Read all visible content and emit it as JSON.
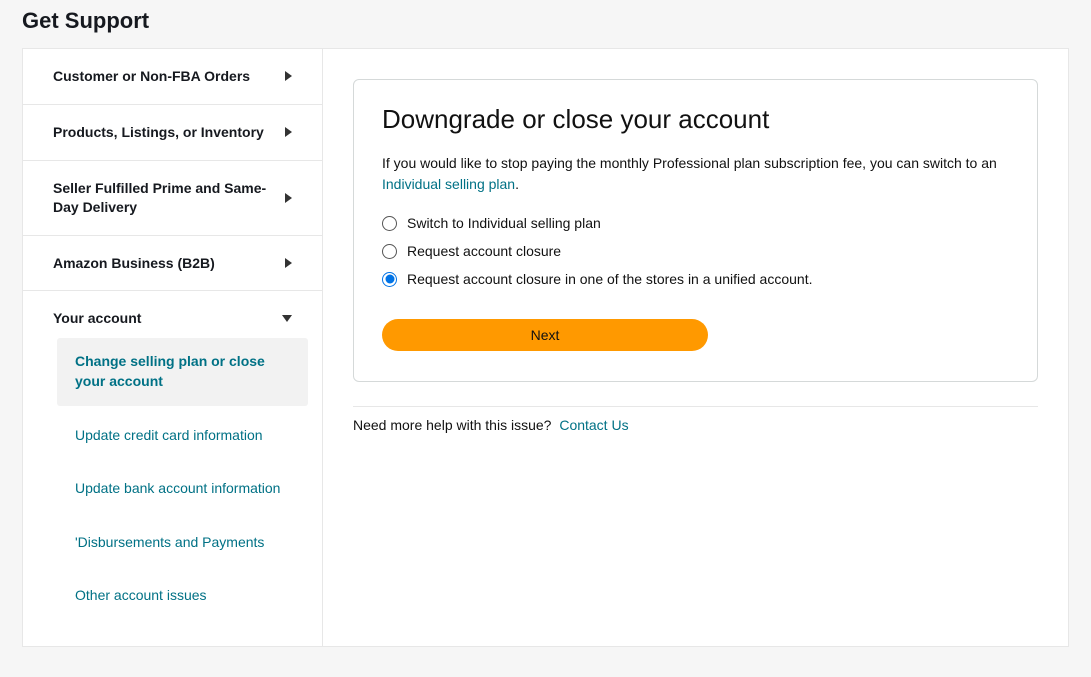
{
  "page": {
    "title": "Get Support"
  },
  "sidebar": {
    "items": [
      {
        "label": "Customer or Non-FBA Orders",
        "expanded": false
      },
      {
        "label": "Products, Listings, or Inventory",
        "expanded": false
      },
      {
        "label": "Seller Fulfilled Prime and Same-Day Delivery",
        "expanded": false
      },
      {
        "label": "Amazon Business (B2B)",
        "expanded": false
      },
      {
        "label": "Your account",
        "expanded": true
      }
    ]
  },
  "sub": {
    "items": [
      {
        "label": "Change selling plan or close your account",
        "active": true
      },
      {
        "label": "Update credit card information",
        "active": false
      },
      {
        "label": "Update bank account information",
        "active": false
      },
      {
        "label": "'Disbursements and Payments",
        "active": false
      },
      {
        "label": "Other account issues",
        "active": false
      }
    ]
  },
  "panel": {
    "heading": "Downgrade or close your account",
    "desc_prefix": "If you would like to stop paying the monthly Professional plan subscription fee, you can switch to an ",
    "desc_link": "Individual selling plan",
    "desc_suffix": ".",
    "options": [
      {
        "label": "Switch to Individual selling plan",
        "selected": false
      },
      {
        "label": "Request account closure",
        "selected": false
      },
      {
        "label": "Request account closure in one of the stores in a unified account.",
        "selected": true
      }
    ],
    "next_label": "Next"
  },
  "help": {
    "prompt": "Need more help with this issue?",
    "link": "Contact Us"
  }
}
